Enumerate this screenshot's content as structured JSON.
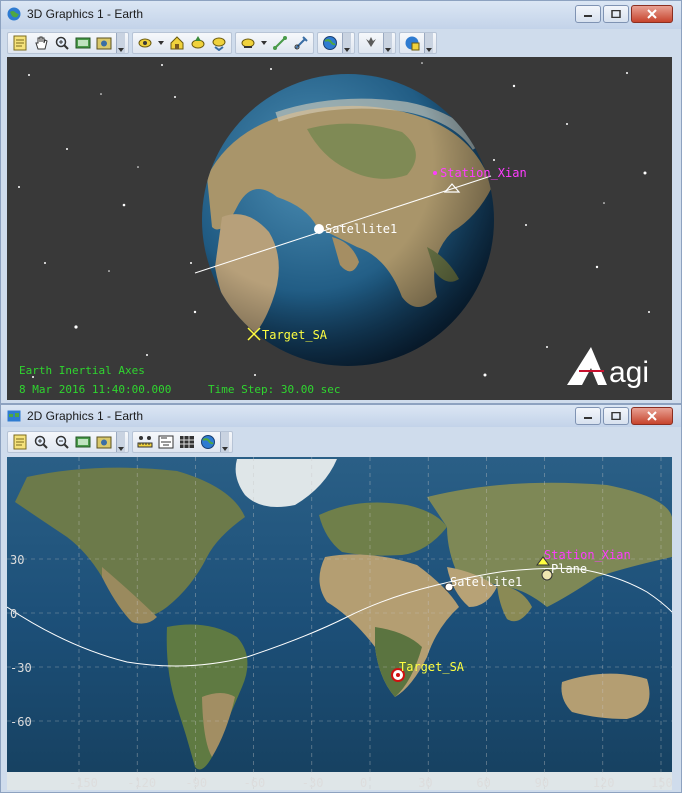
{
  "window3d": {
    "title": "3D Graphics 1 - Earth",
    "overlay": {
      "axes_label": "Earth Inertial Axes",
      "datetime": "8 Mar 2016 11:40:00.000",
      "timestep": "Time Step: 30.00 sec",
      "logo_text": "agi"
    },
    "objects": {
      "station": "Station_Xian",
      "satellite": "Satellite1",
      "target": "Target_SA"
    },
    "toolbar_icons": [
      "properties-icon",
      "pan-hand-icon",
      "zoom-icon",
      "record-icon",
      "snapshot-icon",
      "view-from-icon",
      "home-view-icon",
      "north-up-icon",
      "view-to-icon",
      "pick-icon",
      "measure-icon",
      "globe-icon",
      "bookmark-icon",
      "globe-manager-icon"
    ]
  },
  "window2d": {
    "title": "2D Graphics 1 - Earth",
    "objects": {
      "station": "Station_Xian",
      "satellite": "Satellite1",
      "plane": "Plane",
      "target": "Target_SA"
    },
    "lat_labels": [
      "30",
      "0",
      "-30",
      "-60"
    ],
    "lon_labels": [
      "-150",
      "-120",
      "-90",
      "-60",
      "-30",
      "0",
      "30",
      "60",
      "90",
      "120",
      "150"
    ],
    "toolbar_icons": [
      "properties-icon",
      "zoom-in-icon",
      "zoom-out-icon",
      "record-icon",
      "snapshot-icon",
      "scale-icon",
      "ratio-icon",
      "grid-icon",
      "globe-icon"
    ]
  },
  "colors": {
    "space_bg": "#393939",
    "overlay_text": "#2fd62f",
    "station_label": "#ff3cff",
    "target_label": "#ffff40",
    "satellite_label": "#ffffff",
    "grid": "#c8c8c8"
  }
}
